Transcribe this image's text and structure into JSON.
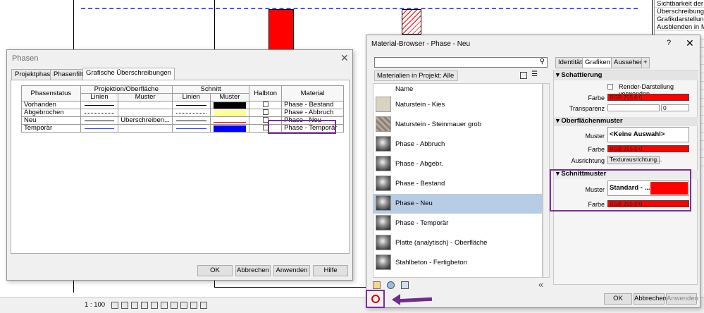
{
  "props_panel": {
    "rows": [
      "Sichtbarkeit der Te",
      "Überschreibungen",
      "Grafikdarstellungs",
      "Ausblenden in Ma"
    ]
  },
  "statusbar": {
    "scale": "1 : 100"
  },
  "phasen_dialog": {
    "title": "Phasen",
    "close": "✕",
    "tabs": [
      "Projektphasen",
      "Phasenfilter",
      "Grafische Überschreibungen"
    ],
    "columns": {
      "phasenstatus": "Phasenstatus",
      "projektion": "Projektion/Oberfläche",
      "schnitt": "Schnitt",
      "linien": "Linien",
      "muster": "Muster",
      "halbton": "Halbton",
      "material": "Material"
    },
    "rows": [
      {
        "status": "Vorhanden",
        "proj_muster": "",
        "material": "Phase - Bestand",
        "swatch": "#000000"
      },
      {
        "status": "Abgebrochen",
        "proj_muster": "",
        "material": "Phase - Abbruch",
        "swatch": "#ffff99"
      },
      {
        "status": "Neu",
        "proj_muster": "Überschreiben...",
        "material": "Phase - Neu",
        "swatch": "#ffffff"
      },
      {
        "status": "Temporär",
        "proj_muster": "",
        "material": "Phase - Temporär",
        "swatch": "#0000ff"
      }
    ],
    "buttons": {
      "ok": "OK",
      "cancel": "Abbrechen",
      "apply": "Anwenden",
      "help": "Hilfe"
    }
  },
  "material_browser": {
    "title": "Material-Browser - Phase - Neu",
    "help": "?",
    "close": "✕",
    "filter": "Materialien in Projekt: Alle",
    "list_header": "Name",
    "items": [
      {
        "name": "Naturstein - Kies",
        "thumb": "kies"
      },
      {
        "name": "Naturstein - Steinmauer grob",
        "thumb": "stein"
      },
      {
        "name": "Phase - Abbruch",
        "thumb": "sphere"
      },
      {
        "name": "Phase - Abgebr.",
        "thumb": "sphere"
      },
      {
        "name": "Phase - Bestand",
        "thumb": "sphere"
      },
      {
        "name": "Phase - Neu",
        "thumb": "sphere",
        "selected": true
      },
      {
        "name": "Phase - Temporär",
        "thumb": "sphere"
      },
      {
        "name": "Platte (analytisch) - Oberfläche",
        "thumb": "sphere"
      },
      {
        "name": "Stahlbeton - Fertigbeton",
        "thumb": "sphere"
      }
    ],
    "tabs": [
      "Identität",
      "Grafiken",
      "Aussehen",
      "+"
    ],
    "sections": {
      "schattierung": {
        "header": "Schattierung",
        "render_label": "Render-Darstellung verwenden",
        "farbe_label": "Farbe",
        "farbe_value": "RGB 255 0 0",
        "transparenz_label": "Transparenz",
        "transparenz_value": "0"
      },
      "oberflaechenmuster": {
        "header": "Oberflächenmuster",
        "muster_label": "Muster",
        "muster_value": "<Keine Auswahl>",
        "farbe_label": "Farbe",
        "farbe_value": "RGB 255 0 0",
        "ausrichtung_label": "Ausrichtung",
        "ausrichtung_value": "Texturausrichtung..."
      },
      "schnittmuster": {
        "header": "Schnittmuster",
        "muster_label": "Muster",
        "muster_value": "Standard - ...",
        "farbe_label": "Farbe",
        "farbe_value": "RGB 255 0 0"
      }
    },
    "buttons": {
      "ok": "OK",
      "cancel": "Abbrechen",
      "apply": "Anwenden"
    }
  },
  "colors": {
    "accent": "#6f2c91",
    "selection": "#b7cde6",
    "red": "#ff0000"
  }
}
